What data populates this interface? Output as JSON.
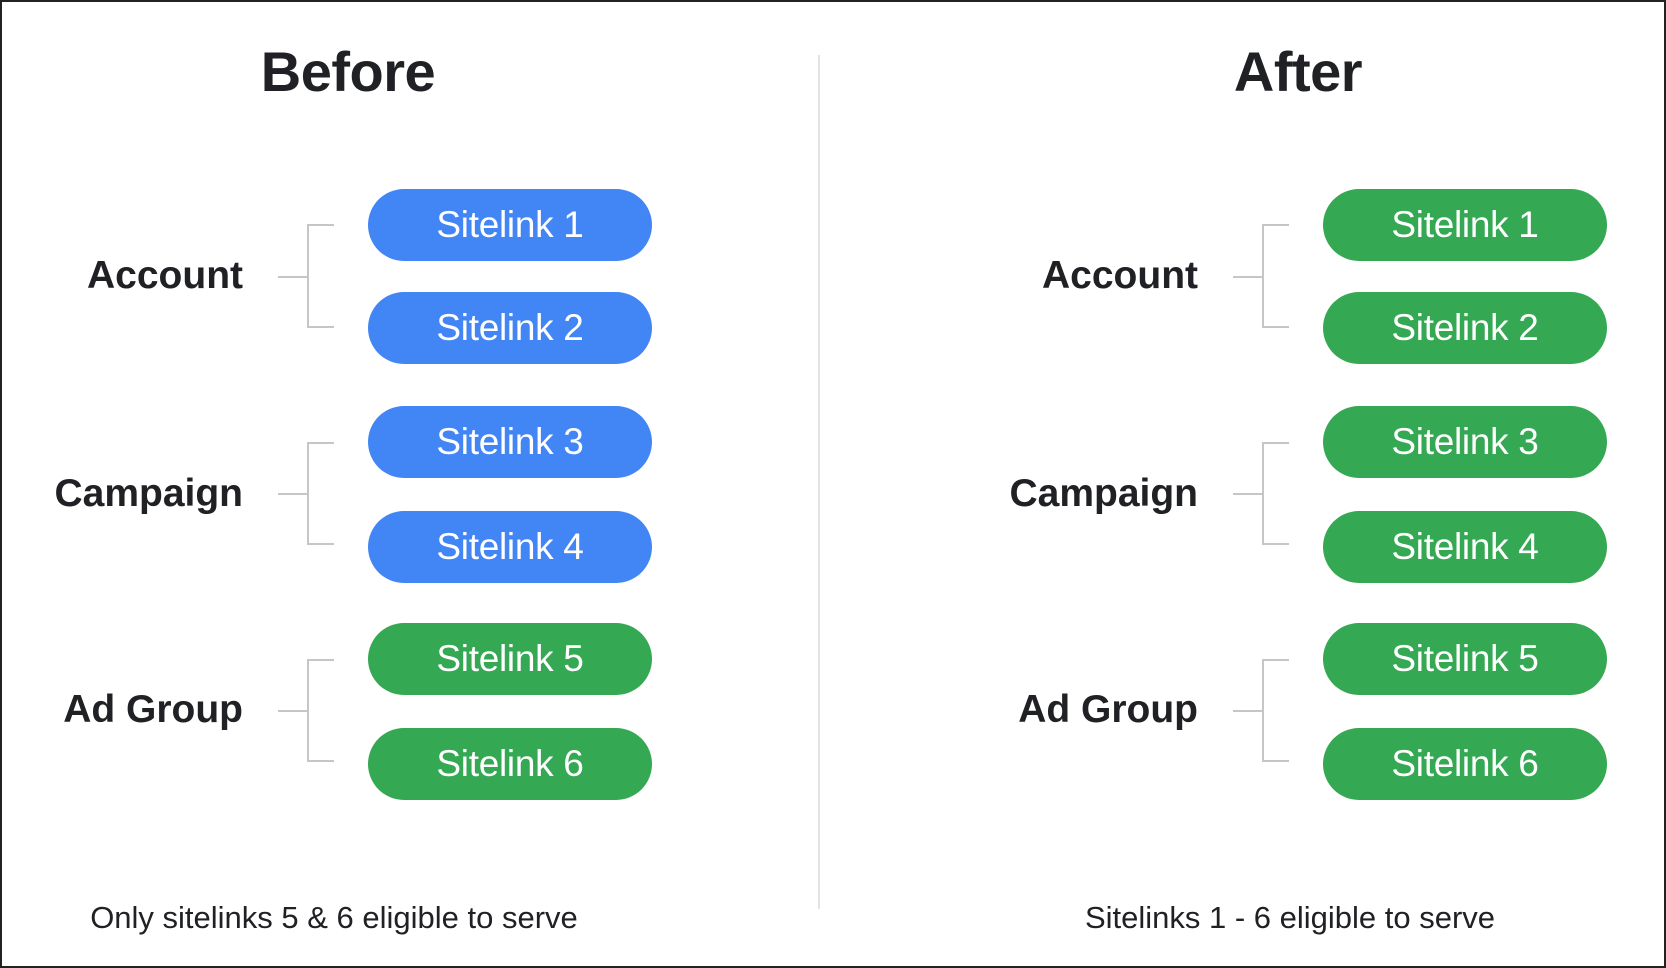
{
  "colors": {
    "not_eligible": "#4285f4",
    "eligible": "#34a853",
    "text": "#202124",
    "connector": "#c4c7c5",
    "divider": "#e3e3e3"
  },
  "before": {
    "title": "Before",
    "groups": [
      {
        "label": "Account",
        "sitelinks": [
          {
            "label": "Sitelink 1",
            "status": "not_eligible"
          },
          {
            "label": "Sitelink 2",
            "status": "not_eligible"
          }
        ]
      },
      {
        "label": "Campaign",
        "sitelinks": [
          {
            "label": "Sitelink 3",
            "status": "not_eligible"
          },
          {
            "label": "Sitelink 4",
            "status": "not_eligible"
          }
        ]
      },
      {
        "label": "Ad Group",
        "sitelinks": [
          {
            "label": "Sitelink 5",
            "status": "eligible"
          },
          {
            "label": "Sitelink 6",
            "status": "eligible"
          }
        ]
      }
    ],
    "caption": "Only sitelinks 5 & 6 eligible to serve"
  },
  "after": {
    "title": "After",
    "groups": [
      {
        "label": "Account",
        "sitelinks": [
          {
            "label": "Sitelink 1",
            "status": "eligible"
          },
          {
            "label": "Sitelink 2",
            "status": "eligible"
          }
        ]
      },
      {
        "label": "Campaign",
        "sitelinks": [
          {
            "label": "Sitelink 3",
            "status": "eligible"
          },
          {
            "label": "Sitelink 4",
            "status": "eligible"
          }
        ]
      },
      {
        "label": "Ad Group",
        "sitelinks": [
          {
            "label": "Sitelink 5",
            "status": "eligible"
          },
          {
            "label": "Sitelink 6",
            "status": "eligible"
          }
        ]
      }
    ],
    "caption": "Sitelinks 1 - 6 eligible to serve"
  }
}
